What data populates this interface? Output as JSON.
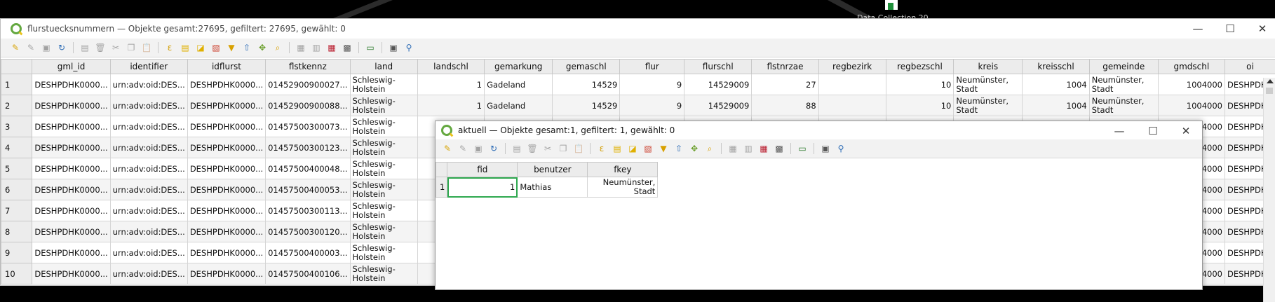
{
  "desktop": {
    "label": "Data Collection 20"
  },
  "main_window": {
    "title": "flurstuecksnummern — Objekte gesamt:27695, gefiltert: 27695, gewählt: 0",
    "controls": {
      "minimize": "—",
      "maximize": "☐",
      "close": "✕"
    },
    "columns": [
      "gml_id",
      "identifier",
      "idflurst",
      "flstkennz",
      "land",
      "landschl",
      "gemarkung",
      "gemaschl",
      "flur",
      "flurschl",
      "flstnrzae",
      "regbezirk",
      "regbezschl",
      "kreis",
      "kreisschl",
      "gemeinde",
      "gmdschl",
      "oi"
    ],
    "rows": [
      {
        "n": "1",
        "gml_id": "DESHPDHK0000...",
        "identifier": "urn:adv:oid:DES...",
        "idflurst": "DESHPDHK0000...",
        "flstkennz": "01452900900027...",
        "land": "Schleswig-Holstein",
        "landschl": "1",
        "gemarkung": "Gadeland",
        "gemaschl": "14529",
        "flur": "9",
        "flurschl": "14529009",
        "flstnrzae": "27",
        "regbezirk": "",
        "regbezschl": "10",
        "kreis": "Neumünster, Stadt",
        "kreisschl": "1004",
        "gemeinde": "Neumünster, Stadt",
        "gmdschl": "1004000",
        "oi": "DESHPDH"
      },
      {
        "n": "2",
        "gml_id": "DESHPDHK0000...",
        "identifier": "urn:adv:oid:DES...",
        "idflurst": "DESHPDHK0000...",
        "flstkennz": "01452900900088...",
        "land": "Schleswig-Holstein",
        "landschl": "1",
        "gemarkung": "Gadeland",
        "gemaschl": "14529",
        "flur": "9",
        "flurschl": "14529009",
        "flstnrzae": "88",
        "regbezirk": "",
        "regbezschl": "10",
        "kreis": "Neumünster, Stadt",
        "kreisschl": "1004",
        "gemeinde": "Neumünster, Stadt",
        "gmdschl": "1004000",
        "oi": "DESHPDH"
      },
      {
        "n": "3",
        "gml_id": "DESHPDHK0000...",
        "identifier": "urn:adv:oid:DES...",
        "idflurst": "DESHPDHK0000...",
        "flstkennz": "01457500300073...",
        "land": "Schleswig-Holstein",
        "gmdschl": "1004000",
        "oi": "DESHPDH"
      },
      {
        "n": "4",
        "gml_id": "DESHPDHK0000...",
        "identifier": "urn:adv:oid:DES...",
        "idflurst": "DESHPDHK0000...",
        "flstkennz": "01457500300123...",
        "land": "Schleswig-Holstein",
        "gmdschl": "1004000",
        "oi": "DESHPDH"
      },
      {
        "n": "5",
        "gml_id": "DESHPDHK0000...",
        "identifier": "urn:adv:oid:DES...",
        "idflurst": "DESHPDHK0000...",
        "flstkennz": "01457500400048...",
        "land": "Schleswig-Holstein",
        "gmdschl": "1004000",
        "oi": "DESHPDH"
      },
      {
        "n": "6",
        "gml_id": "DESHPDHK0000...",
        "identifier": "urn:adv:oid:DES...",
        "idflurst": "DESHPDHK0000...",
        "flstkennz": "01457500400053...",
        "land": "Schleswig-Holstein",
        "gmdschl": "1004000",
        "oi": "DESHPDH"
      },
      {
        "n": "7",
        "gml_id": "DESHPDHK0000...",
        "identifier": "urn:adv:oid:DES...",
        "idflurst": "DESHPDHK0000...",
        "flstkennz": "01457500300113...",
        "land": "Schleswig-Holstein",
        "gmdschl": "1004000",
        "oi": "DESHPDH"
      },
      {
        "n": "8",
        "gml_id": "DESHPDHK0000...",
        "identifier": "urn:adv:oid:DES...",
        "idflurst": "DESHPDHK0000...",
        "flstkennz": "01457500300120...",
        "land": "Schleswig-Holstein",
        "gmdschl": "1004000",
        "oi": "DESHPDH"
      },
      {
        "n": "9",
        "gml_id": "DESHPDHK0000...",
        "identifier": "urn:adv:oid:DES...",
        "idflurst": "DESHPDHK0000...",
        "flstkennz": "01457500400003...",
        "land": "Schleswig-Holstein",
        "gmdschl": "1004000",
        "oi": "DESHPDH"
      },
      {
        "n": "10",
        "gml_id": "DESHPDHK0000...",
        "identifier": "urn:adv:oid:DES...",
        "idflurst": "DESHPDHK0000...",
        "flstkennz": "01457500400106...",
        "land": "Schleswig-Holstein",
        "gmdschl": "1004000",
        "oi": "DESHPDH"
      }
    ]
  },
  "sub_window": {
    "title": "aktuell — Objekte gesamt:1, gefiltert: 1, gewählt: 0",
    "controls": {
      "minimize": "—",
      "maximize": "☐",
      "close": "✕"
    },
    "columns": [
      "fid",
      "benutzer",
      "fkey"
    ],
    "rows": [
      {
        "n": "1",
        "fid": "1",
        "benutzer": "Mathias",
        "fkey": "Neumünster, Stadt"
      }
    ]
  },
  "toolbar_icons": [
    "edit-pencil-icon",
    "multi-edit-icon",
    "save-icon",
    "reload-icon",
    "add-feature-icon",
    "delete-feature-icon",
    "cut-icon",
    "copy-icon",
    "paste-icon",
    "expression-select-icon",
    "select-all-icon",
    "invert-selection-icon",
    "deselect-icon",
    "filter-icon",
    "move-to-top-icon",
    "pan-to-selection-icon",
    "zoom-to-selection-icon",
    "new-field-icon",
    "delete-field-icon",
    "field-calculator-icon",
    "conditional-format-icon",
    "dock-icon",
    "actions-icon",
    "zoom-icon"
  ]
}
